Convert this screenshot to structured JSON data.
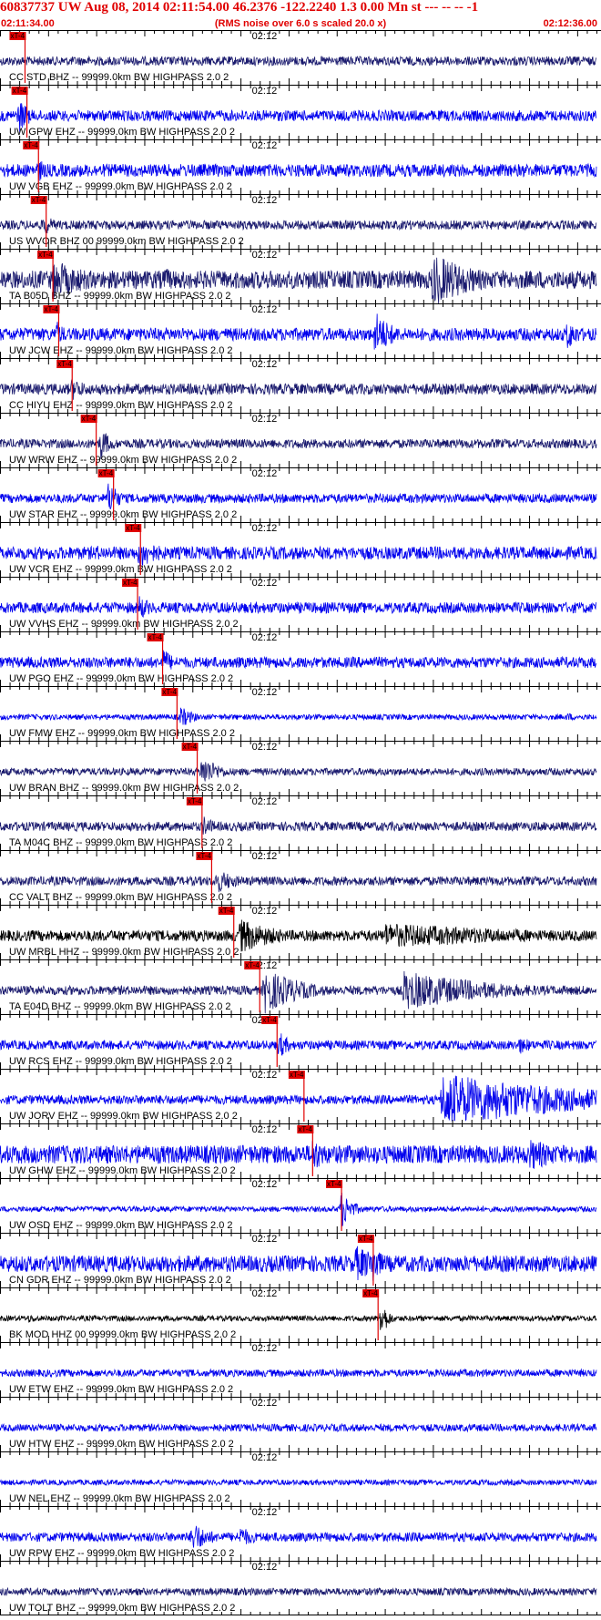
{
  "header": {
    "title": "60837737 UW Aug 08, 2014 02:11:54.00   46.2376 -122.2240  1.3 0.00 Mn st --- -- --   -1",
    "start_time": "02:11:34.00",
    "end_time": "02:12:36.00",
    "subtitle": "(RMS noise over 6.0 s scaled 20.0 x)"
  },
  "chart_data": {
    "type": "seismogram",
    "x_start": "02:11:34.00",
    "x_end": "02:12:36.00",
    "time_mark_label": "02:12",
    "pick_label": "xT-4",
    "colors": {
      "trace_blue": "#0000ee",
      "trace_navy": "#1a1a6e",
      "trace_black": "#000000",
      "pick": "#e00000",
      "axis": "#000000"
    },
    "stations": [
      {
        "label": "CC STD BHZ -- 99999.0km BW  HIGHPASS  2.0  2",
        "pick_s": 2.6,
        "amp": 5,
        "color": "trace_navy",
        "bursts": [
          [
            53.5,
            1.0,
            6
          ]
        ]
      },
      {
        "label": "UW GPW EHZ -- 99999.0km BW  HIGHPASS  2.0  2",
        "pick_s": 2.8,
        "amp": 6,
        "color": "trace_blue",
        "bursts": [
          [
            2.0,
            1.2,
            20
          ]
        ]
      },
      {
        "label": "UW VGB EHZ -- 99999.0km BW  HIGHPASS  2.0  2",
        "pick_s": 4.0,
        "amp": 7,
        "color": "trace_blue",
        "bursts": [
          [
            4.0,
            1.2,
            14
          ]
        ]
      },
      {
        "label": "US WVOR BHZ 00 99999.0km BW  HIGHPASS  2.0  2",
        "pick_s": 4.8,
        "amp": 5,
        "color": "trace_navy",
        "bursts": [
          [
            4.5,
            1.6,
            12
          ]
        ]
      },
      {
        "label": "TA B05D BHZ -- 99999.0km BW  HIGHPASS  2.0  2",
        "pick_s": 5.5,
        "amp": 10,
        "color": "trace_navy",
        "bursts": [
          [
            5.5,
            5,
            22
          ],
          [
            17,
            3,
            14
          ],
          [
            45,
            5,
            30
          ]
        ]
      },
      {
        "label": "UW JCW EHZ -- 99999.0km BW  HIGHPASS  2.0  2",
        "pick_s": 6.1,
        "amp": 7,
        "color": "trace_blue",
        "bursts": [
          [
            5.8,
            1.2,
            16
          ],
          [
            39,
            2,
            26
          ],
          [
            59,
            1.5,
            18
          ]
        ]
      },
      {
        "label": "CC HIYU EHZ -- 99999.0km BW  HIGHPASS  2.0  2",
        "pick_s": 7.5,
        "amp": 6,
        "color": "trace_navy",
        "bursts": [
          [
            7.5,
            2,
            13
          ]
        ]
      },
      {
        "label": "UW WRW EHZ -- 99999.0km BW  HIGHPASS  2.0  2",
        "pick_s": 10.0,
        "amp": 5,
        "color": "trace_navy",
        "bursts": [
          [
            10.5,
            1.2,
            18
          ]
        ]
      },
      {
        "label": "UW STAR EHZ -- 99999.0km BW  HIGHPASS  2.0  2",
        "pick_s": 11.8,
        "amp": 5,
        "color": "trace_blue",
        "bursts": [
          [
            11.3,
            1.2,
            20
          ],
          [
            8,
            1,
            8
          ]
        ]
      },
      {
        "label": "UW VCR EHZ -- 99999.0km BW  HIGHPASS  2.0  2",
        "pick_s": 14.6,
        "amp": 7,
        "color": "trace_blue",
        "bursts": [
          [
            14.5,
            2.5,
            18
          ],
          [
            10,
            1,
            10
          ]
        ]
      },
      {
        "label": "UW VVHS EHZ -- 99999.0km BW  HIGHPASS  2.0  2",
        "pick_s": 14.3,
        "amp": 6,
        "color": "trace_blue",
        "bursts": [
          [
            14.5,
            1.5,
            14
          ]
        ]
      },
      {
        "label": "UW PGO EHZ -- 99999.0km BW  HIGHPASS  2.0  2",
        "pick_s": 16.9,
        "amp": 6,
        "color": "trace_blue",
        "bursts": [
          [
            17,
            1.2,
            16
          ]
        ]
      },
      {
        "label": "UW FMW EHZ -- 99999.0km BW  HIGHPASS  2.0  2",
        "pick_s": 18.4,
        "amp": 3,
        "color": "trace_blue",
        "bursts": [
          [
            18.8,
            1.5,
            12
          ],
          [
            59,
            1.5,
            5
          ]
        ]
      },
      {
        "label": "UW BRAN BHZ -- 99999.0km BW  HIGHPASS  2.0  2",
        "pick_s": 20.5,
        "amp": 4,
        "color": "trace_navy",
        "bursts": [
          [
            21,
            2,
            18
          ]
        ]
      },
      {
        "label": "TA M04C BHZ -- 99999.0km BW  HIGHPASS  2.0  2",
        "pick_s": 21.0,
        "amp": 5,
        "color": "trace_navy",
        "bursts": [
          [
            21.2,
            1.5,
            12
          ]
        ]
      },
      {
        "label": "CC VALT BHZ -- 99999.0km BW  HIGHPASS  2.0  2",
        "pick_s": 22.0,
        "amp": 5,
        "color": "trace_navy",
        "bursts": [
          [
            22.5,
            2.5,
            14
          ]
        ]
      },
      {
        "label": "UW MRBL HHZ -- 99999.0km BW  HIGHPASS  2.0  2",
        "pick_s": 24.3,
        "amp": 6,
        "color": "trace_black",
        "bursts": [
          [
            25,
            4,
            20
          ],
          [
            40,
            20,
            14
          ]
        ]
      },
      {
        "label": "TA E04D BHZ -- 99999.0km BW  HIGHPASS  2.0  2",
        "pick_s": 27.0,
        "amp": 5,
        "color": "trace_navy",
        "bursts": [
          [
            27.5,
            4,
            26
          ],
          [
            42,
            10,
            22
          ]
        ]
      },
      {
        "label": "UW RCS EHZ -- 99999.0km BW  HIGHPASS  2.0  2",
        "pick_s": 28.8,
        "amp": 5,
        "color": "trace_blue",
        "bursts": [
          [
            29,
            1.2,
            16
          ],
          [
            54,
            2,
            10
          ]
        ]
      },
      {
        "label": "UW JORV EHZ -- 99999.0km BW  HIGHPASS  2.0  2",
        "pick_s": 31.6,
        "amp": 5,
        "color": "trace_blue",
        "bursts": [
          [
            46,
            16,
            30
          ]
        ]
      },
      {
        "label": "UW GHW EHZ -- 99999.0km BW  HIGHPASS  2.0  2",
        "pick_s": 32.5,
        "amp": 10,
        "color": "trace_blue",
        "bursts": [
          [
            32.5,
            2,
            20
          ],
          [
            55,
            5,
            18
          ]
        ]
      },
      {
        "label": "UW OSD EHZ -- 99999.0km BW  HIGHPASS  2.0  2",
        "pick_s": 35.5,
        "amp": 3,
        "color": "trace_blue",
        "bursts": [
          [
            35.5,
            1.2,
            22
          ]
        ]
      },
      {
        "label": "CN GDR EHZ -- 99999.0km BW  HIGHPASS  2.0  2",
        "pick_s": 38.8,
        "amp": 9,
        "color": "trace_blue",
        "bursts": [
          [
            37,
            4,
            20
          ],
          [
            38.8,
            1,
            26
          ]
        ]
      },
      {
        "label": "BK MOD HHZ 00 99999.0km BW  HIGHPASS  2.0  2",
        "pick_s": 39.3,
        "amp": 3,
        "color": "trace_black",
        "bursts": [
          [
            3,
            2,
            5
          ],
          [
            39.6,
            0.8,
            22
          ]
        ]
      },
      {
        "label": "UW ETW EHZ -- 99999.0km BW  HIGHPASS  2.0  2",
        "pick_s": null,
        "amp": 4,
        "color": "trace_blue",
        "bursts": []
      },
      {
        "label": "UW HTW EHZ -- 99999.0km BW  HIGHPASS  2.0  2",
        "pick_s": null,
        "amp": 4,
        "color": "trace_blue",
        "bursts": []
      },
      {
        "label": "UW NEL EHZ -- 99999.0km BW  HIGHPASS  2.0  2",
        "pick_s": null,
        "amp": 3,
        "color": "trace_blue",
        "bursts": []
      },
      {
        "label": "UW RPW EHZ -- 99999.0km BW  HIGHPASS  2.0  2",
        "pick_s": null,
        "amp": 5,
        "color": "trace_blue",
        "bursts": [
          [
            20,
            2,
            18
          ],
          [
            25,
            2,
            12
          ]
        ]
      },
      {
        "label": "UW TOLT BHZ -- 99999.0km BW  HIGHPASS  2.0  2",
        "pick_s": null,
        "amp": 4,
        "color": "trace_navy",
        "bursts": []
      }
    ]
  }
}
